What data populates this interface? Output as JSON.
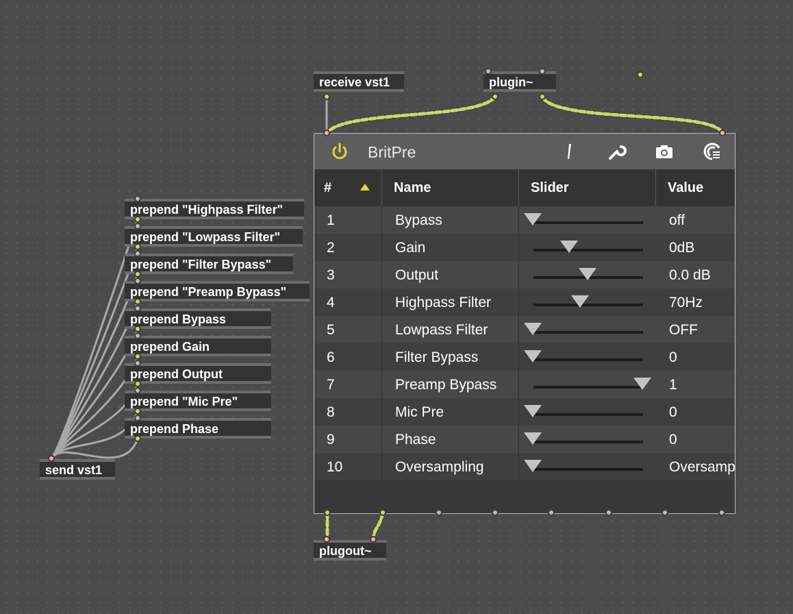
{
  "objects": {
    "receive": "receive vst1",
    "plugin": "plugin~",
    "plugout": "plugout~",
    "send": "send vst1",
    "prepends": [
      "prepend \"Highpass Filter\"",
      "prepend \"Lowpass Filter\"",
      "prepend \"Filter Bypass\"",
      "prepend \"Preamp Bypass\"",
      "prepend Bypass",
      "prepend Gain",
      "prepend Output",
      "prepend \"Mic Pre\"",
      "prepend Phase"
    ]
  },
  "vst": {
    "title": "BritPre",
    "icons": [
      "power-icon",
      "pencil-icon",
      "wrench-icon",
      "camera-icon",
      "presets-icon"
    ],
    "columns": {
      "index": "#",
      "name": "Name",
      "slider": "Slider",
      "value": "Value"
    },
    "params": [
      {
        "index": "1",
        "name": "Bypass",
        "value": "off",
        "level": 0.0
      },
      {
        "index": "2",
        "name": "Gain",
        "value": "0dB",
        "level": 0.33
      },
      {
        "index": "3",
        "name": "Output",
        "value": "0.0 dB",
        "level": 0.5
      },
      {
        "index": "4",
        "name": "Highpass Filter",
        "value": "70Hz",
        "level": 0.43
      },
      {
        "index": "5",
        "name": "Lowpass Filter",
        "value": "OFF",
        "level": 0.0
      },
      {
        "index": "6",
        "name": "Filter Bypass",
        "value": "0",
        "level": 0.0
      },
      {
        "index": "7",
        "name": "Preamp Bypass",
        "value": "1",
        "level": 1.0
      },
      {
        "index": "8",
        "name": "Mic Pre",
        "value": "0",
        "level": 0.0
      },
      {
        "index": "9",
        "name": "Phase",
        "value": "0",
        "level": 0.0
      },
      {
        "index": "10",
        "name": "Oversampling",
        "value": "Oversampling",
        "level": 0.0
      }
    ]
  },
  "colors": {
    "accent": "#e5d62a",
    "signal_wire": "#c9d86a",
    "message_wire": "#a8a8a8",
    "panel_border": "#a8c4cf"
  }
}
